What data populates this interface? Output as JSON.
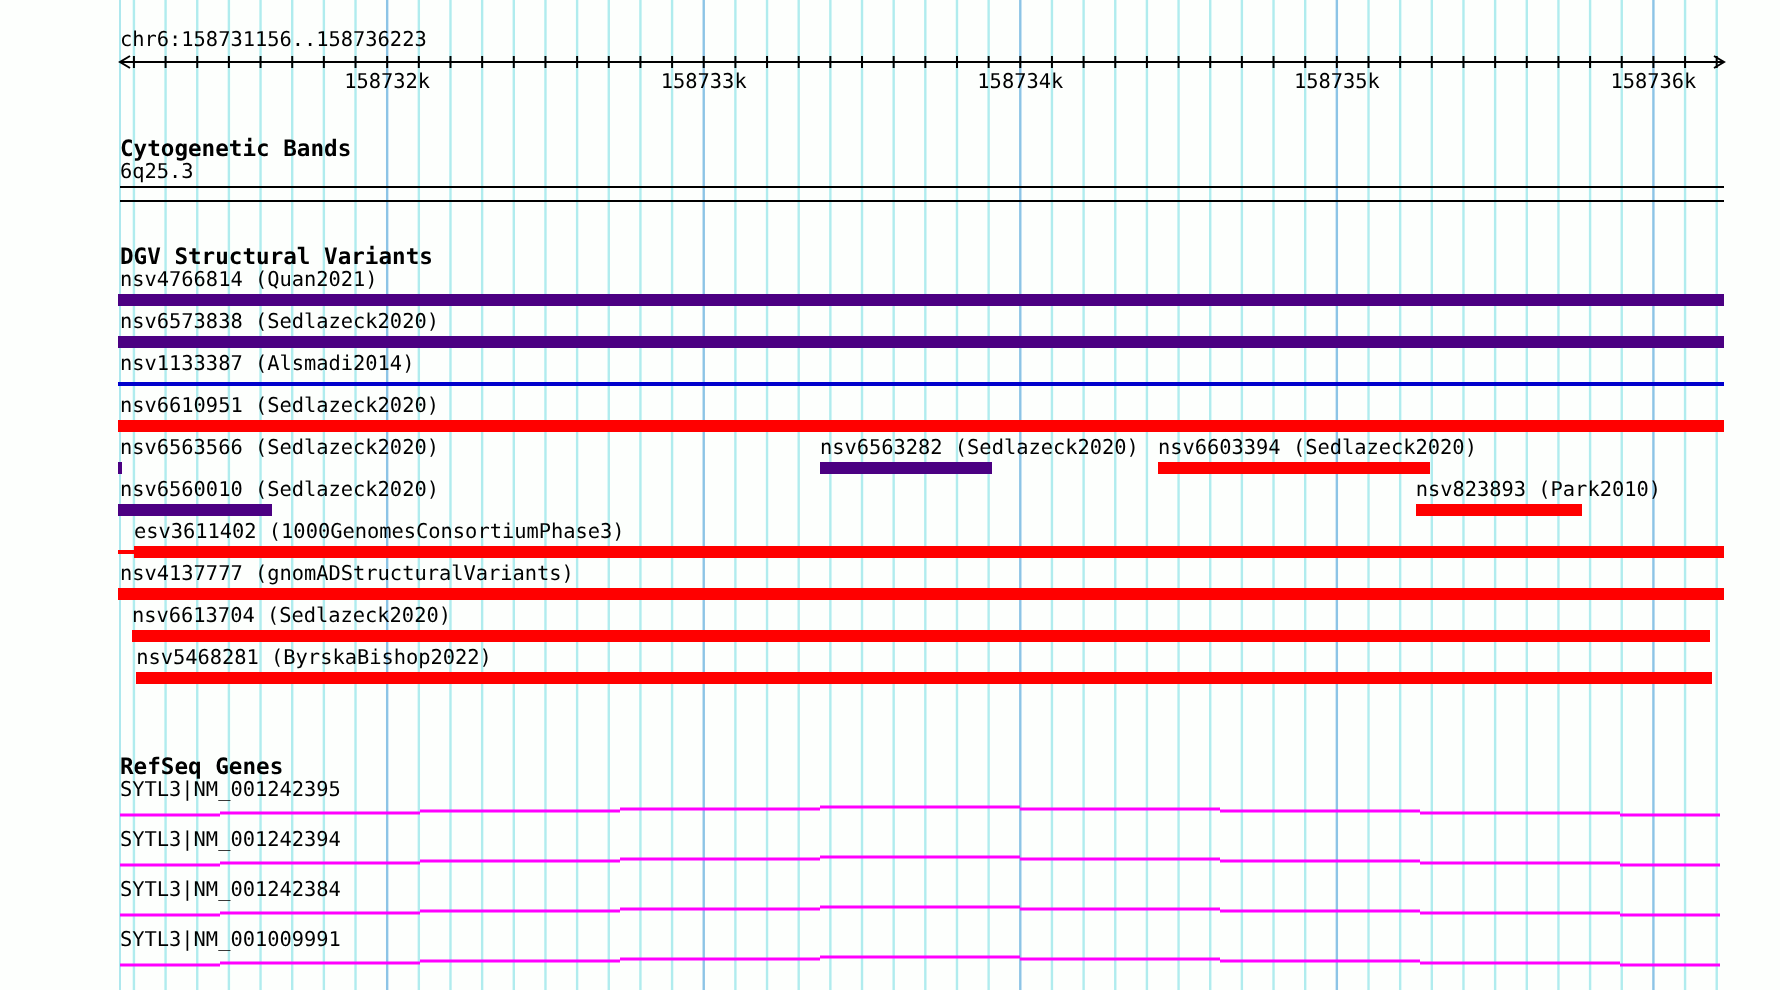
{
  "location": "chr6:158731156..158736223",
  "ruler": {
    "ticks": [
      {
        "label": "158732k"
      },
      {
        "label": "158733k"
      },
      {
        "label": "158734k"
      },
      {
        "label": "158735k"
      },
      {
        "label": "158736k"
      }
    ]
  },
  "tracks": [
    {
      "kind": "cytoband",
      "title": "Cytogenetic Bands",
      "bands": [
        {
          "name": "6q25.3"
        }
      ]
    },
    {
      "kind": "variants",
      "title": "DGV Structural Variants",
      "rows": [
        {
          "features": [
            {
              "name": "nsv4766814 (Quan2021)",
              "kind": "thick",
              "color": "#4b0082"
            }
          ]
        },
        {
          "features": [
            {
              "name": "nsv6573838 (Sedlazeck2020)",
              "kind": "thick",
              "color": "#4b0082"
            }
          ]
        },
        {
          "features": [
            {
              "name": "nsv1133387 (Alsmadi2014)",
              "kind": "thin",
              "color": "#0000cc"
            }
          ]
        },
        {
          "features": [
            {
              "name": "nsv6610951 (Sedlazeck2020)",
              "kind": "thick",
              "color": "#ff0000"
            }
          ]
        },
        {
          "features": [
            {
              "name": "nsv6563566 (Sedlazeck2020)",
              "kind": "thick",
              "color": "#4b0082"
            },
            {
              "name": "nsv6563282 (Sedlazeck2020)",
              "kind": "thick",
              "color": "#4b0082"
            },
            {
              "name": "nsv6603394 (Sedlazeck2020)",
              "kind": "thick",
              "color": "#ff0000"
            }
          ]
        },
        {
          "features": [
            {
              "name": "nsv6560010 (Sedlazeck2020)",
              "kind": "thick",
              "color": "#4b0082"
            },
            {
              "name": "nsv823893 (Park2010)",
              "kind": "thick",
              "color": "#ff0000"
            }
          ]
        },
        {
          "features": [
            {
              "name": "esv3611402 (1000GenomesConsortiumPhase3)",
              "kind": "thick",
              "color": "#ff0000"
            }
          ]
        },
        {
          "features": [
            {
              "name": "nsv4137777 (gnomADStructuralVariants)",
              "kind": "thick",
              "color": "#ff0000"
            }
          ]
        },
        {
          "features": [
            {
              "name": "nsv6613704 (Sedlazeck2020)",
              "kind": "thick",
              "color": "#ff0000"
            }
          ]
        },
        {
          "features": [
            {
              "name": "nsv5468281 (ByrskaBishop2022)",
              "kind": "thick",
              "color": "#ff0000"
            }
          ]
        }
      ]
    },
    {
      "kind": "genes",
      "title": "RefSeq Genes",
      "transcripts": [
        {
          "name": "SYTL3|NM_001242395"
        },
        {
          "name": "SYTL3|NM_001242394"
        },
        {
          "name": "SYTL3|NM_001242384"
        },
        {
          "name": "SYTL3|NM_001009991"
        }
      ]
    }
  ]
}
